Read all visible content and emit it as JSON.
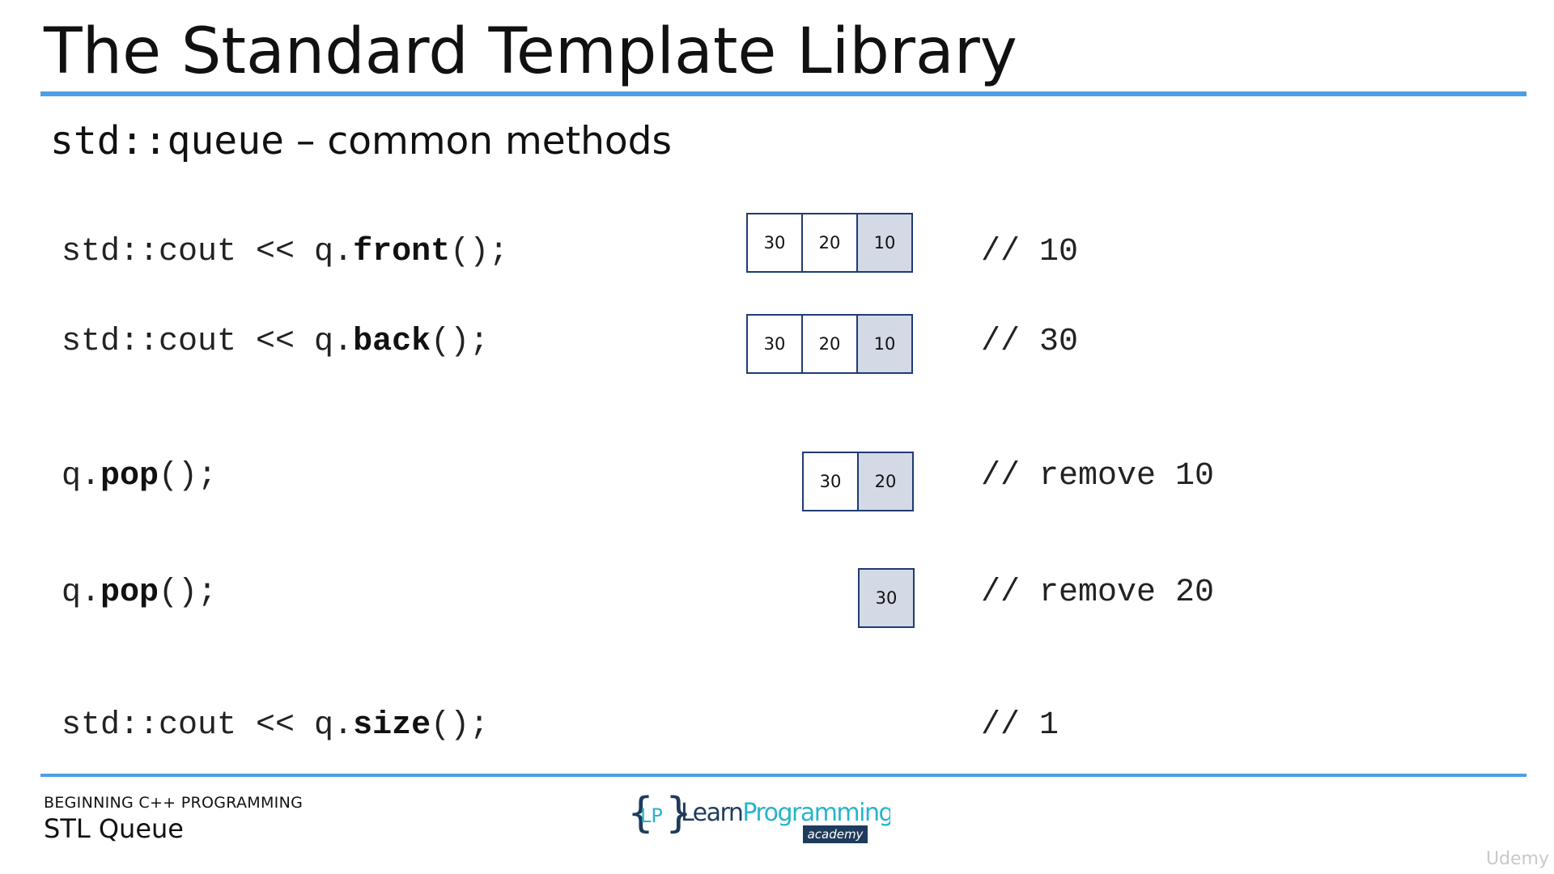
{
  "slide": {
    "title": "The Standard Template Library",
    "subtitle_code": "std::queue",
    "subtitle_text": " – common methods"
  },
  "statements": [
    {
      "prefix": "std::cout << q.",
      "method": "front",
      "suffix": "();",
      "queue": [
        "30",
        "20",
        "10"
      ],
      "comment": "// 10"
    },
    {
      "prefix": "std::cout << q.",
      "method": "back",
      "suffix": "();",
      "queue": [
        "30",
        "20",
        "10"
      ],
      "comment": "// 30"
    },
    {
      "prefix": "q.",
      "method": "pop",
      "suffix": "();",
      "queue": [
        "30",
        "20"
      ],
      "comment": "// remove 10"
    },
    {
      "prefix": "q.",
      "method": "pop",
      "suffix": "();",
      "queue": [
        "30"
      ],
      "comment": "// remove 20"
    },
    {
      "prefix": "std::cout << q.",
      "method": "size",
      "suffix": "();",
      "queue": [],
      "comment": "// 1"
    }
  ],
  "footer": {
    "course": "BEGINNING C++ PROGRAMMING",
    "topic": "STL Queue"
  },
  "logo": {
    "icon": "curly-braces-lp-icon",
    "name": "LearnProgramming",
    "badge": "academy",
    "colors": {
      "dark": "#1f3b5c",
      "teal": "#27b5c9"
    }
  },
  "watermark": "Udemy",
  "colors": {
    "accent_rule": "#4f9ee4",
    "cell_border": "#1f3b73",
    "front_cell_fill": "#d3d9e5"
  }
}
